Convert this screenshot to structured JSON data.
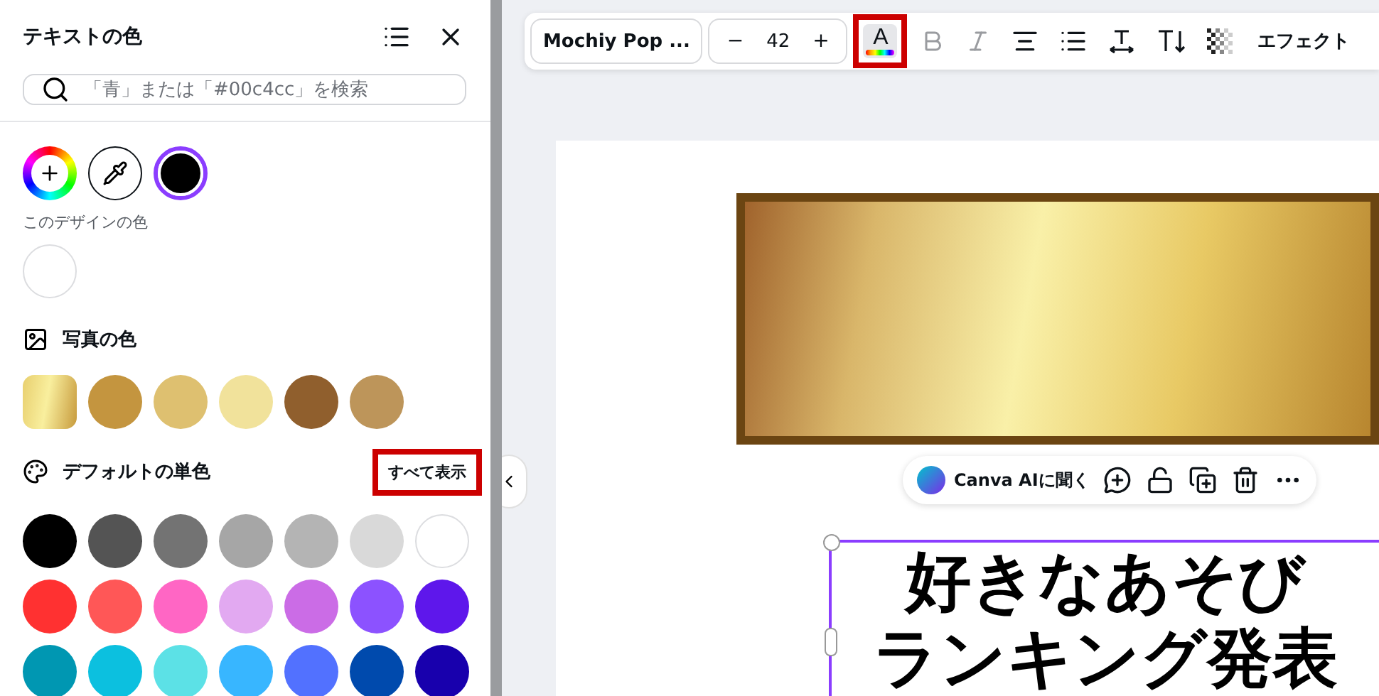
{
  "panel": {
    "title": "テキストの色",
    "search": {
      "placeholder": "「青」または「#00c4cc」を検索"
    },
    "current_colors": [
      {
        "kind": "add"
      },
      {
        "kind": "picker"
      },
      {
        "kind": "swatch",
        "color": "#000000",
        "selected": true
      }
    ],
    "design_colors": {
      "label": "このデザインの色",
      "swatches": [
        {
          "color": "#ffffff",
          "selected": false
        }
      ]
    },
    "photo_colors": {
      "label": "写真の色",
      "swatches": [
        {
          "kind": "gradient",
          "color": "#e8cf6e",
          "selected": false
        },
        {
          "kind": "solid",
          "color": "#c4953f",
          "selected": false
        },
        {
          "kind": "solid",
          "color": "#dec070",
          "selected": false
        },
        {
          "kind": "solid",
          "color": "#f1e29b",
          "selected": false
        },
        {
          "kind": "solid",
          "color": "#905f2d",
          "selected": false
        },
        {
          "kind": "solid",
          "color": "#bd955a",
          "selected": false
        }
      ]
    },
    "default_colors": {
      "label": "デフォルトの単色",
      "show_all": "すべて表示",
      "show_all_highlighted": true,
      "rows": [
        {
          "swatches": [
            {
              "color": "#000000"
            },
            {
              "color": "#545454"
            },
            {
              "color": "#737373"
            },
            {
              "color": "#a6a6a6"
            },
            {
              "color": "#b4b4b4"
            },
            {
              "color": "#d9d9d9"
            },
            {
              "color": "#ffffff"
            }
          ]
        },
        {
          "swatches": [
            {
              "color": "#ff3131"
            },
            {
              "color": "#ff5757"
            },
            {
              "color": "#ff66c4"
            },
            {
              "color": "#e2a9f1"
            },
            {
              "color": "#cb6ce6"
            },
            {
              "color": "#8c52ff"
            },
            {
              "color": "#5e17eb"
            }
          ]
        },
        {
          "swatches": [
            {
              "color": "#0097b2"
            },
            {
              "color": "#0cc0df"
            },
            {
              "color": "#5ce1e6"
            },
            {
              "color": "#38b6ff"
            },
            {
              "color": "#5271ff"
            },
            {
              "color": "#004aad"
            },
            {
              "color": "#1800ad"
            }
          ]
        }
      ]
    }
  },
  "toolbar": {
    "font": "Mochiy Pop ...",
    "size_minus": "−",
    "size": "42",
    "size_plus": "+",
    "text_color_letter": "A",
    "text_color_highlighted": true,
    "effects": "エフェクト"
  },
  "float_menu": {
    "ai_label": "Canva AIに聞く"
  },
  "canvas": {
    "text_lines": [
      "好きなあそび",
      "ランキング発表"
    ]
  }
}
